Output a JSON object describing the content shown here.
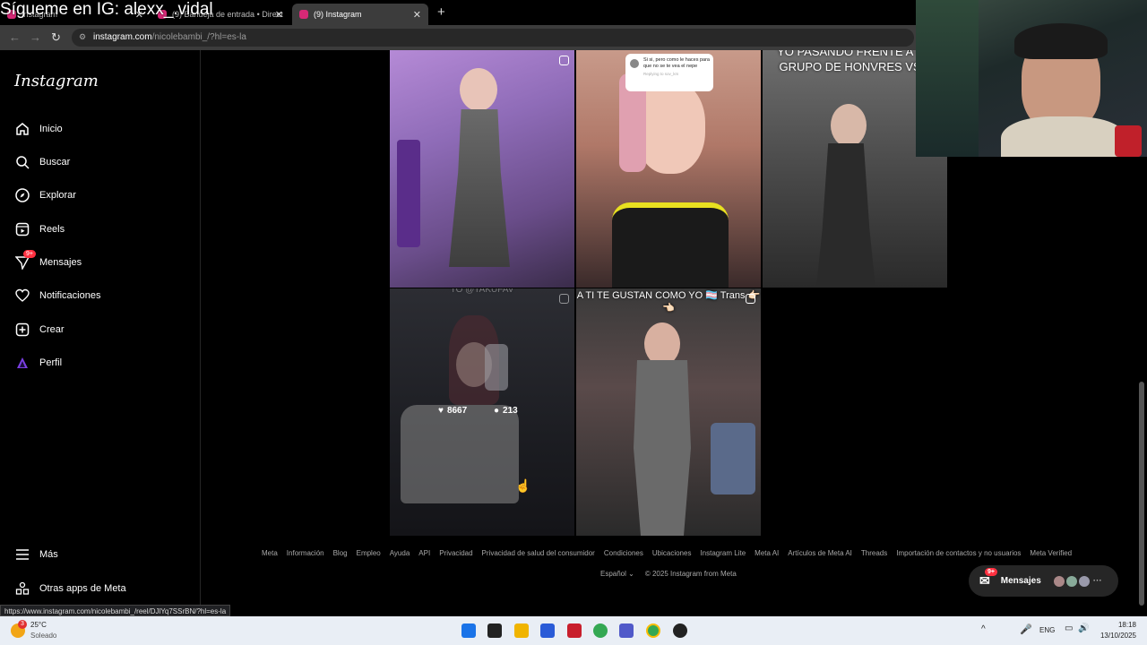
{
  "overlay": {
    "text": "Sígueme en IG: alexx_.vidal"
  },
  "browser": {
    "tabs": [
      {
        "label": "Instagram",
        "active": false
      },
      {
        "label": "(9) Bandeja de entrada • Direct",
        "active": false
      },
      {
        "label": "(9) Instagram",
        "active": true
      }
    ],
    "new_tab": "+",
    "url_host": "instagram.com",
    "url_path": "/nicolebambi_/?hl=es-la"
  },
  "sidebar": {
    "logo": "Instagram",
    "items": [
      {
        "label": "Inicio",
        "icon": "home-icon"
      },
      {
        "label": "Buscar",
        "icon": "search-icon"
      },
      {
        "label": "Explorar",
        "icon": "compass-icon"
      },
      {
        "label": "Reels",
        "icon": "reels-icon"
      },
      {
        "label": "Mensajes",
        "icon": "messenger-icon",
        "badge": "9+"
      },
      {
        "label": "Notificaciones",
        "icon": "heart-icon"
      },
      {
        "label": "Crear",
        "icon": "plus-square-icon"
      },
      {
        "label": "Perfil",
        "icon": "avatar-icon"
      }
    ],
    "more": "Más",
    "meta_apps": "Otras apps de Meta"
  },
  "grid": {
    "captions": [
      "",
      "Si si, pero como le haces para que no se te vea el nepe",
      "YO PASANDO FRENTE A UN GRUPO DE HONVRES VS...",
      "TO @TAKUFAV",
      "A TI TE GUSTAN COMO YO 🏳️‍⚧️ Trans 👉🏻👈🏻"
    ],
    "reply_meta": "Replying to sov_km",
    "hover_likes": "8667",
    "hover_comments": "213"
  },
  "footer": {
    "links": [
      "Meta",
      "Información",
      "Blog",
      "Empleo",
      "Ayuda",
      "API",
      "Privacidad",
      "Privacidad de salud del consumidor",
      "Condiciones",
      "Ubicaciones",
      "Instagram Lite",
      "Meta AI",
      "Artículos de Meta AI",
      "Threads",
      "Importación de contactos y no usuarios",
      "Meta Verified"
    ],
    "language": "Español",
    "copyright": "© 2025 Instagram from Meta"
  },
  "messages_pill": {
    "label": "Mensajes",
    "badge": "9+"
  },
  "status_url": "https://www.instagram.com/nicolebambi_/reel/DJlYq7SSrBN/?hl=es-la",
  "taskbar": {
    "weather_temp": "25°C",
    "weather_desc": "Soleado",
    "weather_badge": "3",
    "lang": "ENG",
    "time": "18:18",
    "date": "13/10/2025"
  },
  "colors": {
    "accent_badge": "#ff3040",
    "bg": "#000000",
    "taskbar": "#e9eef5"
  }
}
